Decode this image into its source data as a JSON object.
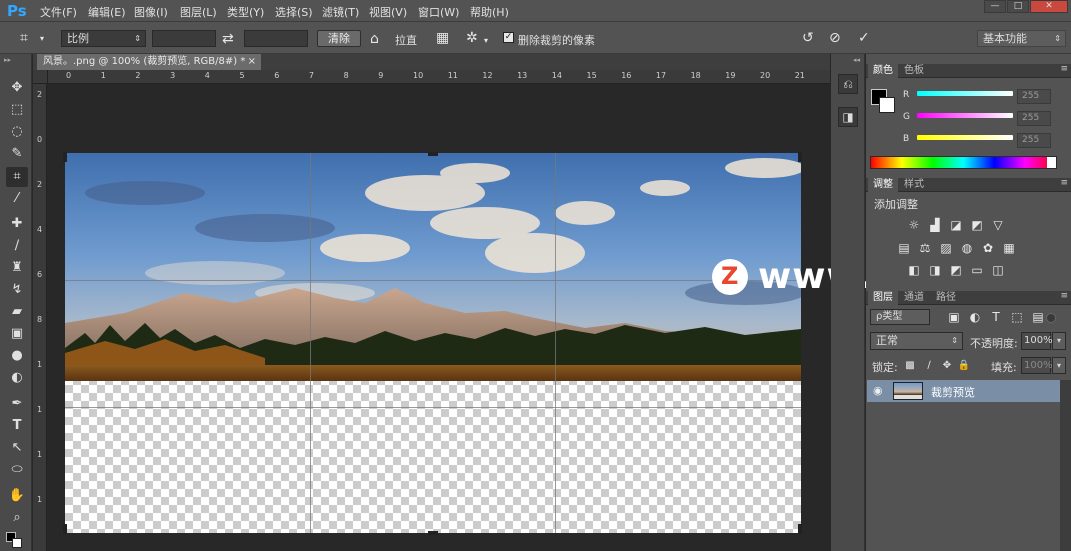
{
  "app": {
    "logo": "Ps"
  },
  "menu": [
    "文件(F)",
    "编辑(E)",
    "图像(I)",
    "图层(L)",
    "类型(Y)",
    "选择(S)",
    "滤镜(T)",
    "视图(V)",
    "窗口(W)",
    "帮助(H)"
  ],
  "window_controls": {
    "minimize": "—",
    "maximize": "□",
    "close": "✕"
  },
  "options": {
    "ratio_select": "比例",
    "ratio_w": "",
    "ratio_h": "",
    "clear_label": "清除",
    "straighten_label": "拉直",
    "delete_cropped_label": "删除裁剪的像素",
    "delete_cropped_checked": true,
    "workspace": "基本功能"
  },
  "document": {
    "tab_title": "风景。.png @ 100% (裁剪预览, RGB/8#) *",
    "ruler_top": [
      "0",
      "1",
      "2",
      "3",
      "4",
      "5",
      "6",
      "7",
      "8",
      "9",
      "10",
      "11",
      "12",
      "13",
      "14",
      "15",
      "16",
      "17",
      "18",
      "19",
      "20",
      "21",
      "22"
    ],
    "ruler_left": [
      "2",
      "0",
      "2",
      "4",
      "6",
      "8",
      "1",
      "1",
      "1",
      "1"
    ]
  },
  "watermark": {
    "text": "www.MacZ.com",
    "badge": "Z"
  },
  "color_panel": {
    "tabs": [
      "颜色",
      "色板"
    ],
    "channels": [
      {
        "name": "R",
        "value": "255",
        "color": "#3fe6e6"
      },
      {
        "name": "G",
        "value": "255",
        "color": "#e63fe6"
      },
      {
        "name": "B",
        "value": "255",
        "color": "#e6e63f"
      }
    ]
  },
  "adjustments_panel": {
    "tabs": [
      "调整",
      "样式"
    ],
    "title": "添加调整"
  },
  "layers_panel": {
    "tabs": [
      "图层",
      "通道",
      "路径"
    ],
    "filter_kind": "ρ类型",
    "blend_mode": "正常",
    "opacity_label": "不透明度:",
    "opacity_value": "100%",
    "lock_label": "锁定:",
    "fill_label": "填充:",
    "fill_value": "100%",
    "layers": [
      {
        "name": "裁剪预览",
        "visible": true
      }
    ]
  }
}
